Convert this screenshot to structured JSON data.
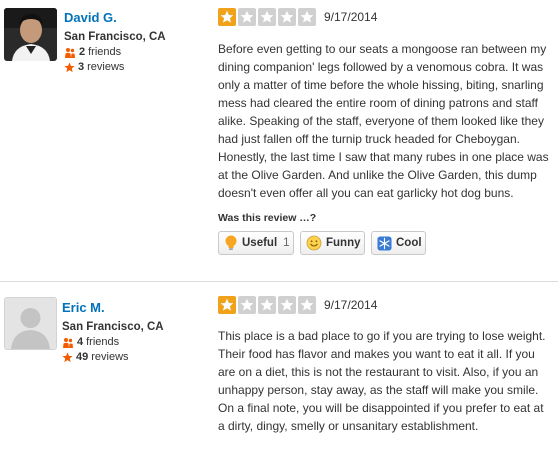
{
  "reviews": [
    {
      "user": {
        "name": "David G.",
        "location": "San Francisco, CA",
        "friends_count": "2",
        "friends_label": "friends",
        "reviews_count": "3",
        "reviews_label": "reviews"
      },
      "rating": 1,
      "max_rating": 5,
      "date": "9/17/2014",
      "text": "Before even getting to our seats a mongoose ran between my dining companion' legs followed by a venomous cobra. It was only a matter of time before the whole hissing, biting, snarling mess had cleared the entire room of dining patrons and staff alike. Speaking of the staff, everyone of them looked like they had just fallen off the turnip truck headed for Cheboygan. Honestly, the last time I saw that many rubes in one place was at the Olive Garden. And unlike the Olive Garden, this dump doesn't even offer all you can eat garlicky hot dog buns.",
      "helpful_prompt": "Was this review …?",
      "votes": {
        "useful_label": "Useful",
        "useful_count": "1",
        "funny_label": "Funny",
        "cool_label": "Cool"
      }
    },
    {
      "user": {
        "name": "Eric M.",
        "location": "San Francisco, CA",
        "friends_count": "4",
        "friends_label": "friends",
        "reviews_count": "49",
        "reviews_label": "reviews"
      },
      "rating": 1,
      "max_rating": 5,
      "date": "9/17/2014",
      "text": "This place is a bad place to go if you are trying to lose weight. Their food has flavor and makes you want to eat it all. If you are on a diet, this is not the restaurant to visit. Also, if you an unhappy person, stay away, as the staff will make you smile. On a final note, you will be disappointed if you prefer to eat at a dirty, dingy, smelly or unsanitary establishment."
    }
  ],
  "colors": {
    "star_filled": "#f0a21a",
    "star_empty": "#d0d0d0",
    "user_name": "#0073bb",
    "friends_icon": "#f15c00",
    "reviews_icon": "#f15c00"
  },
  "icons": {
    "star": "star-icon",
    "friends": "friends-icon",
    "reviews": "reviews-star-icon",
    "useful": "lightbulb-icon",
    "funny": "smiley-icon",
    "cool": "snowflake-icon"
  }
}
